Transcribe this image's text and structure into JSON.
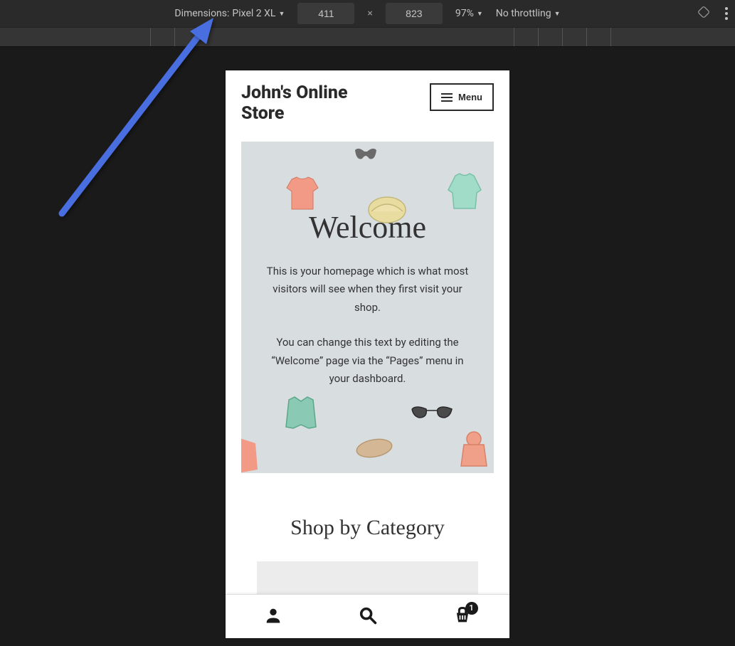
{
  "devtools": {
    "dimensions_label": "Dimensions:",
    "device": "Pixel 2 XL",
    "width": "411",
    "height": "823",
    "zoom": "97%",
    "throttling": "No throttling"
  },
  "site": {
    "title": "John's Online Store",
    "menu_label": "Menu",
    "hero_title": "Welcome",
    "hero_p1": "This is your homepage which is what most visitors will see when they first visit your shop.",
    "hero_p2": "You can change this text by editing the “Welcome” page via the “Pages” menu in your dashboard.",
    "shop_heading": "Shop by Category",
    "cart_count": "1"
  }
}
